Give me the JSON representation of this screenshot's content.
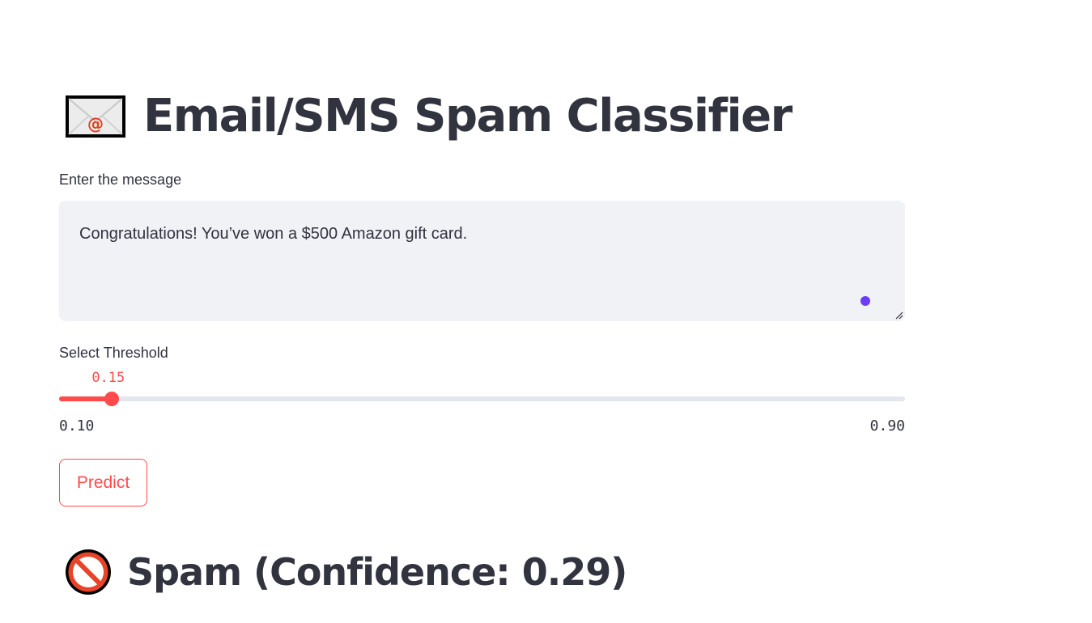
{
  "page": {
    "title": "Email/SMS Spam Classifier",
    "title_icon": "envelope-with-at-icon"
  },
  "message_input": {
    "label": "Enter the message",
    "value": "Congratulations! You’ve won a $500 Amazon gift card."
  },
  "threshold_slider": {
    "label": "Select Threshold",
    "value": 0.15,
    "value_text": "0.15",
    "min": 0.1,
    "min_text": "0.10",
    "max": 0.9,
    "max_text": "0.90"
  },
  "predict_button": {
    "label": "Predict"
  },
  "result": {
    "icon": "prohibited-icon",
    "text": "Spam (Confidence: 0.29)"
  },
  "colors": {
    "accent": "#ff4b4b",
    "text": "#31333f",
    "input_bg": "#f0f2f6",
    "track": "#e4e7ee",
    "cursor_dot": "#6c3df2"
  }
}
